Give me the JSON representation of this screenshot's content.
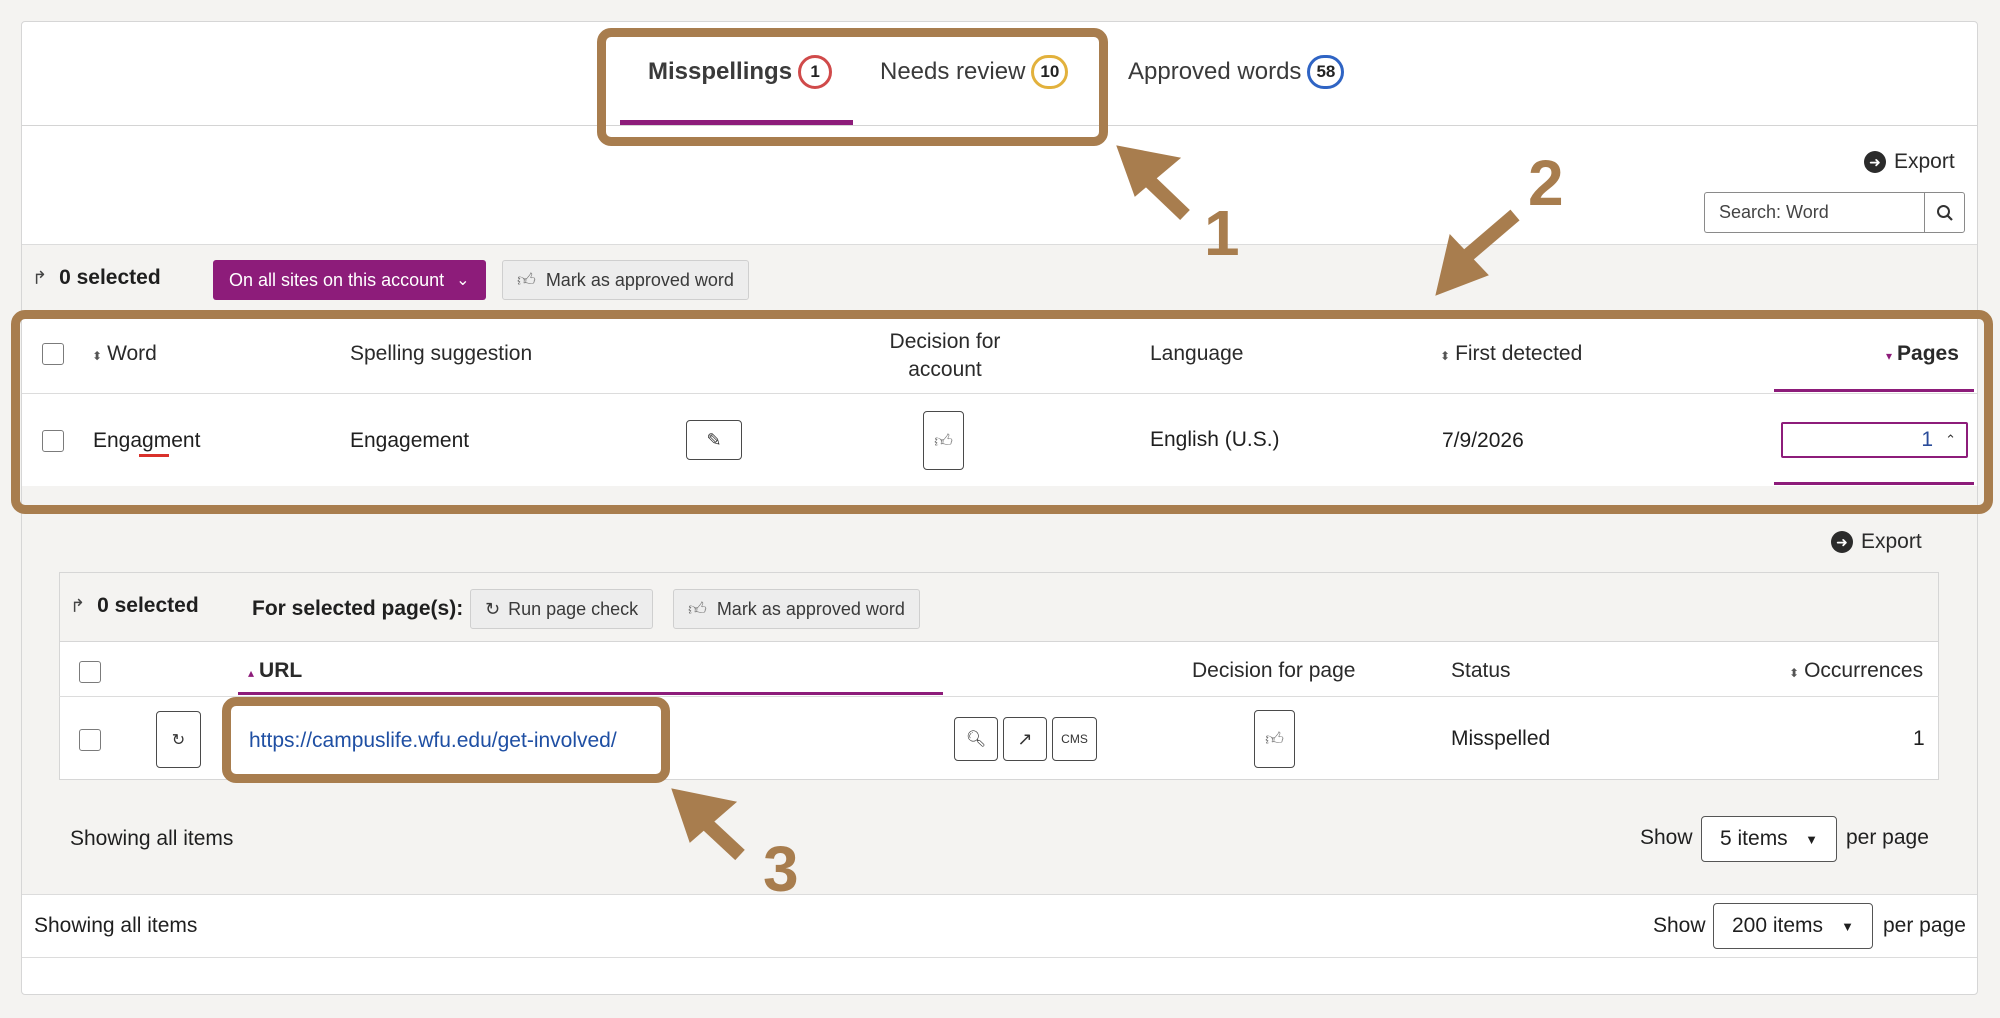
{
  "tabs": [
    {
      "label": "Misspellings",
      "count": "1",
      "color": "#d04a4a"
    },
    {
      "label": "Needs review",
      "count": "10",
      "color": "#e2b13c"
    },
    {
      "label": "Approved words",
      "count": "58",
      "color": "#2f64c4"
    }
  ],
  "toolbar": {
    "export_label": "Export",
    "search_placeholder": "Search: Word",
    "selected_count": "0 selected",
    "scope_label": "On all sites on this account",
    "approve_label": "Mark as approved word"
  },
  "table": {
    "headers": {
      "word": "Word",
      "suggestion": "Spelling suggestion",
      "decision_line1": "Decision for",
      "decision_line2": "account",
      "language": "Language",
      "first_detected": "First detected",
      "pages": "Pages"
    },
    "rows": [
      {
        "word": "Engagment",
        "suggestion": "Engagement",
        "language": "English (U.S.)",
        "first_detected": "7/9/2026",
        "pages": "1"
      }
    ]
  },
  "subpanel": {
    "export_label": "Export",
    "selected_count": "0 selected",
    "for_selected_label": "For selected page(s):",
    "run_check_label": "Run page check",
    "approve_label": "Mark as approved word",
    "headers": {
      "url": "URL",
      "decision": "Decision for page",
      "status": "Status",
      "occurrences": "Occurrences"
    },
    "rows": [
      {
        "url": "https://campuslife.wfu.edu/get-involved/",
        "cms_label": "CMS",
        "status": "Misspelled",
        "occurrences": "1"
      }
    ],
    "footer": {
      "showing": "Showing all items",
      "show": "Show",
      "items": "5 items",
      "per_page": "per page"
    }
  },
  "footer": {
    "showing": "Showing all items",
    "show": "Show",
    "items": "200 items",
    "per_page": "per page"
  },
  "annotations": {
    "one": "1",
    "two": "2",
    "three": "3",
    "color": "#a87d4e"
  },
  "colors": {
    "accent": "#8d1c7a",
    "link": "#1f4fa3",
    "error": "#d9312b"
  }
}
